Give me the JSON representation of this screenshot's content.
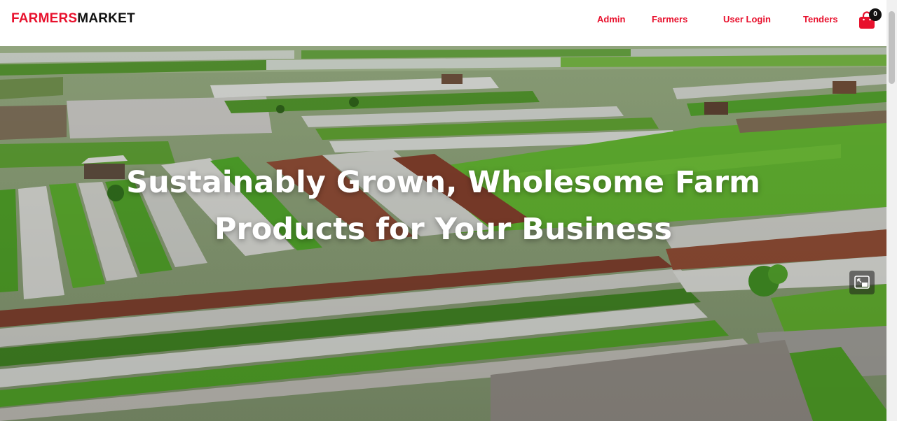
{
  "brand": {
    "part1": "FARMERS",
    "part2": "MARKET"
  },
  "nav": {
    "items": [
      {
        "label": "Admin"
      },
      {
        "label": "Farmers"
      },
      {
        "label": "User Login"
      },
      {
        "label": "Tenders"
      }
    ]
  },
  "cart": {
    "count": "0",
    "icon": "shopping-bag-icon"
  },
  "hero": {
    "title_line1": "Sustainably Grown, Wholesome Farm",
    "title_line2": "Products for Your Business",
    "pip_icon": "picture-in-picture-icon"
  },
  "colors": {
    "accent": "#e8112d",
    "text_dark": "#111111",
    "hero_text": "#ffffff"
  }
}
